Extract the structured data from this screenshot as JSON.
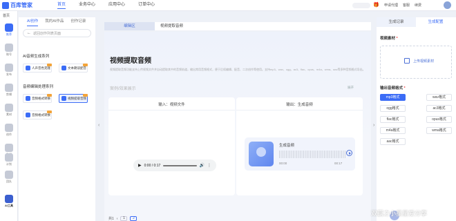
{
  "app": {
    "logo_text": "百库管家"
  },
  "topnav": {
    "items": [
      "首页",
      "业务中心",
      "应用中心",
      "订单中心"
    ],
    "active_index": 0
  },
  "toolbar_right": [
    "申请代理",
    "客服",
    "续费"
  ],
  "rail": {
    "tag": "首页",
    "items": [
      {
        "label": "推荐"
      },
      {
        "label": "账号"
      },
      {
        "label": "发布"
      },
      {
        "label": "剪辑"
      },
      {
        "label": "素材"
      },
      {
        "label": "创作"
      },
      {
        "label": "数据"
      },
      {
        "label": "计划"
      },
      {
        "label": "团队"
      },
      {
        "label": "AI工具"
      }
    ]
  },
  "left_panel": {
    "tabs": [
      "AI创作",
      "我的AI作品",
      "创作记录"
    ],
    "search_placeholder": "返回创作列表页面",
    "groups": [
      {
        "title": "AI音频生成系列",
        "cards": [
          "人声音色克隆",
          "文本朗读配音"
        ]
      },
      {
        "title": "音频编辑处理系列",
        "cards": [
          "音频格式转换",
          "视频提取音频",
          "音频格式转换"
        ]
      }
    ]
  },
  "center": {
    "tabs": [
      "编辑区",
      "视频提取音频"
    ],
    "title": "视频提取音频",
    "description": "视频提取音频功能支持上传视频文件并自动提取其中的音频轨道，输出常用音频格式，便于后续编辑、配音、二次创作等使用。支持mp3、wav、ogg、ac3、flac、opus、m4a、wma、aac等多种音频格式导出。",
    "section_label": "案例/效果展示",
    "expand_label": "展开",
    "input_box": {
      "title": "输入：视频文件",
      "time": "0:00 / 0:17"
    },
    "output_box": {
      "title": "输出：生成音频",
      "name": "生成音频",
      "start": "00:00",
      "end": "00:17"
    },
    "pager": {
      "label": "共1",
      "pages": [
        "1",
        "2"
      ]
    }
  },
  "right_panel": {
    "tabs": [
      "生成记录",
      "生成配置"
    ],
    "material_label": "视频素材",
    "upload_text": "上传视频素材",
    "format_label": "输出音频格式",
    "formats": [
      "mp3格式",
      "wav格式",
      "ogg格式",
      "ac3格式",
      "flac格式",
      "opus格式",
      "m4a格式",
      "wma格式",
      "aac格式"
    ],
    "selected_format": "mp3格式"
  },
  "watermark": "双赢之小星星爱分享",
  "colors": {
    "accent": "#3b6cf6",
    "active_tab": "#dde3f2"
  }
}
